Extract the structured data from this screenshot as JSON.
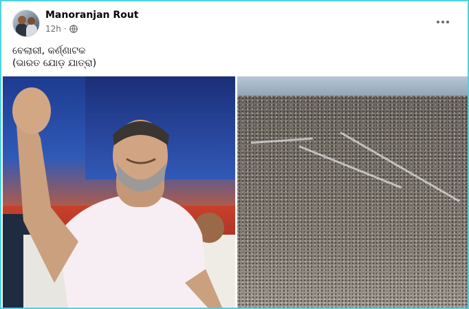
{
  "post": {
    "author": "Manoranjan Rout",
    "time": "12h",
    "separator": "·",
    "caption_line1": "ବେଲାରୀ, କର୍ଣ୍ଣାଟକ",
    "caption_line2": "(ଭାରତ ଯୋଡ଼ ଯାତ୍ରା)"
  },
  "icons": {
    "privacy": "globe-icon",
    "menu": "more-options-icon"
  },
  "colors": {
    "frame_border": "#4fd1e0",
    "secondary_text": "#65676b"
  }
}
